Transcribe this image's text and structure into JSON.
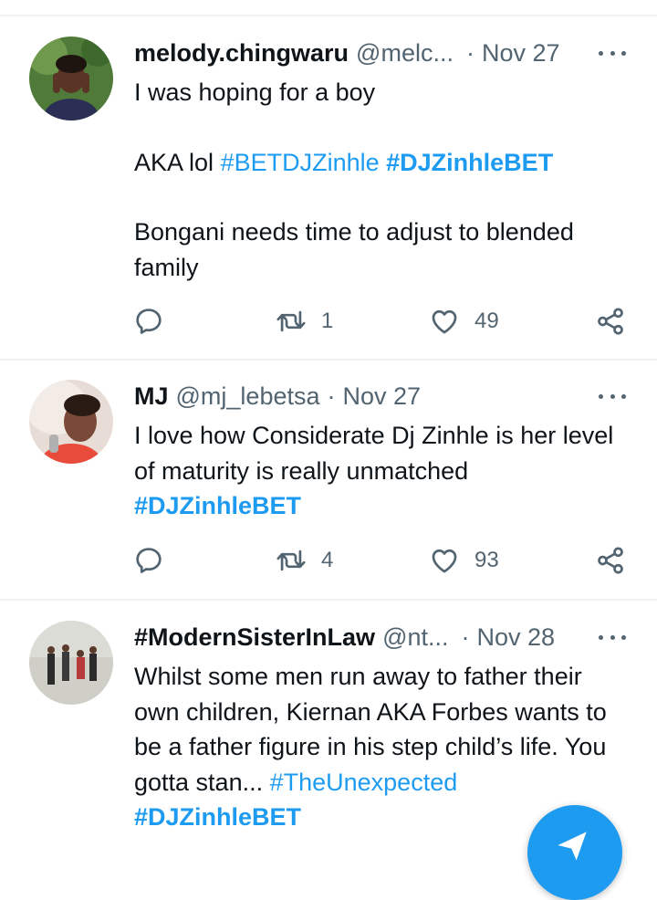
{
  "tweets": [
    {
      "name": "melody.chingwaru",
      "handle": "@melc...",
      "separator": "·",
      "date": "Nov 27",
      "paragraphs": [
        [
          {
            "t": "I was hoping for a boy",
            "k": "text"
          }
        ],
        [
          {
            "t": "AKA lol ",
            "k": "text"
          },
          {
            "t": "#BETDJZinhle",
            "k": "tag"
          },
          {
            "t": " ",
            "k": "text"
          },
          {
            "t": "#DJZinhleBET",
            "k": "tagb"
          }
        ],
        [
          {
            "t": "Bongani needs time to adjust to blended family",
            "k": "text"
          }
        ]
      ],
      "retweets": "1",
      "likes": "49",
      "avatar_colors": [
        "#4f7a3a",
        "#2f4a22",
        "#6b4a3a"
      ]
    },
    {
      "name": "MJ",
      "handle": "@mj_lebetsa",
      "separator": "·",
      "date": "Nov 27",
      "paragraphs": [
        [
          {
            "t": "I love how Considerate Dj Zinhle is her level of maturity is really unmatched ",
            "k": "text"
          },
          {
            "t": "#DJZinhleBET",
            "k": "tagb"
          }
        ]
      ],
      "retweets": "4",
      "likes": "93",
      "avatar_colors": [
        "#d9c3b5",
        "#7a4a38",
        "#e84b3a"
      ]
    },
    {
      "name": "#ModernSisterInLaw",
      "handle": "@nt...",
      "separator": "·",
      "date": "Nov 28",
      "paragraphs": [
        [
          {
            "t": "Whilst some men run away to father their own children, Kiernan AKA Forbes wants to be a father figure in his step child’s life. You gotta stan... ",
            "k": "text"
          },
          {
            "t": "#TheUnexpected",
            "k": "tag"
          },
          {
            "t": " ",
            "k": "text"
          },
          {
            "t": "#DJZinhleBET",
            "k": "tagb"
          }
        ]
      ],
      "retweets": "",
      "likes": "",
      "avatar_colors": [
        "#cfcfc8",
        "#2b2b2b",
        "#b83a3a"
      ]
    }
  ],
  "icons": {
    "reply": "reply-icon",
    "retweet": "retweet-icon",
    "like": "heart-icon",
    "share": "share-icon",
    "more": "more-icon",
    "compose": "compose-icon"
  },
  "colors": {
    "accent": "#1d9bf0",
    "text": "#0f1419",
    "muted": "#536471",
    "divider": "#eff3f4"
  }
}
